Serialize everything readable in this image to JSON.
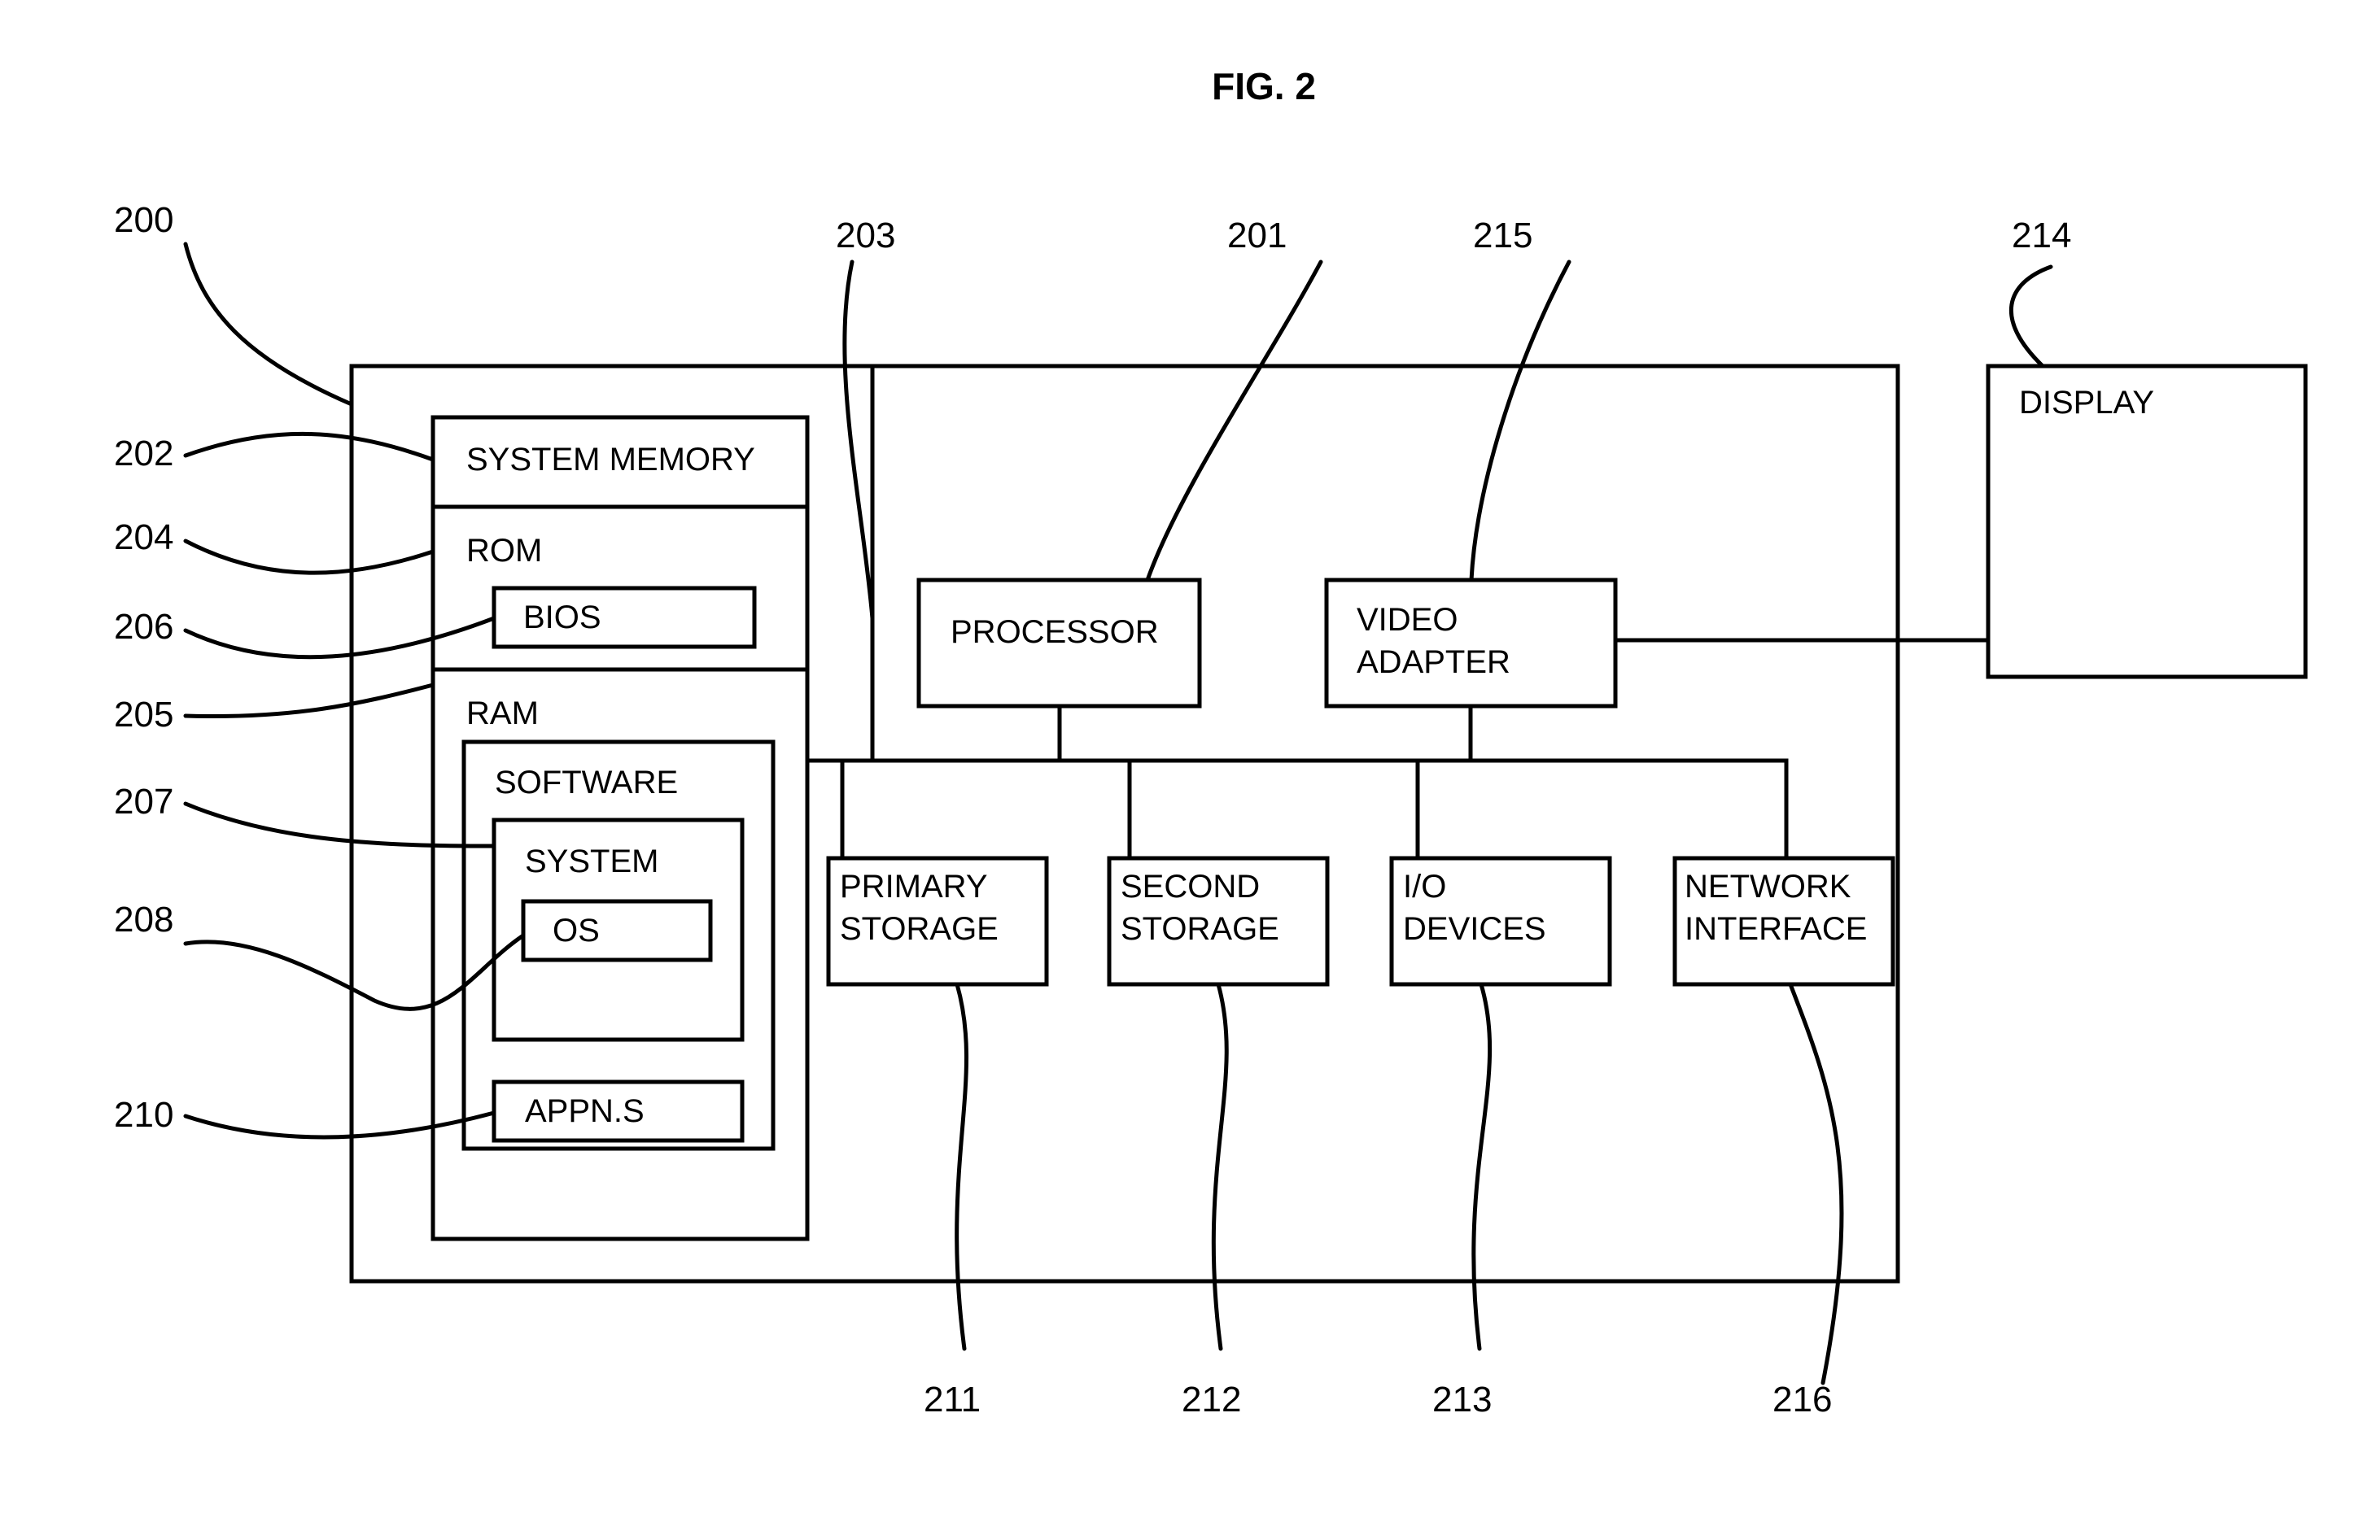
{
  "figure": {
    "title": "FIG. 2",
    "type": "patent-block-diagram"
  },
  "blocks": {
    "system_memory": "SYSTEM MEMORY",
    "rom": "ROM",
    "bios": "BIOS",
    "ram": "RAM",
    "software": "SOFTWARE",
    "system": "SYSTEM",
    "os": "OS",
    "appns": "APPN.S",
    "processor": "PROCESSOR",
    "video_adapter_line1": "VIDEO",
    "video_adapter_line2": "ADAPTER",
    "display": "DISPLAY",
    "primary_storage_line1": "PRIMARY",
    "primary_storage_line2": "STORAGE",
    "second_storage_line1": "SECOND",
    "second_storage_line2": "STORAGE",
    "io_devices_line1": "I/O",
    "io_devices_line2": "DEVICES",
    "network_interface_line1": "NETWORK",
    "network_interface_line2": "INTERFACE"
  },
  "reference_numerals": {
    "computer_system": "200",
    "processor": "201",
    "system_memory": "202",
    "system_bus": "203",
    "rom": "204",
    "ram": "205",
    "bios": "206",
    "system_software": "207",
    "operating_system": "208",
    "applications": "210",
    "primary_storage": "211",
    "second_storage": "212",
    "io_devices": "213",
    "display": "214",
    "video_adapter": "215",
    "network_interface": "216"
  },
  "colors": {
    "ink": "#000000",
    "paper": "#ffffff"
  }
}
